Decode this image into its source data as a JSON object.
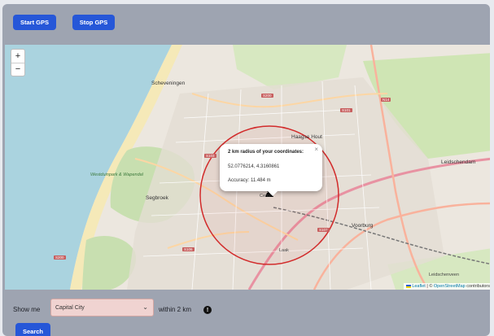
{
  "toolbar": {
    "start_label": "Start GPS",
    "stop_label": "Stop GPS"
  },
  "map": {
    "zoom_in": "+",
    "zoom_out": "−",
    "popup": {
      "close": "×",
      "title": "2 km radius of your coordinates:",
      "coords": "52.0776214, 4.3160861",
      "accuracy": "Accuracy: 11.484 m"
    },
    "attribution": {
      "leaflet": "Leaflet",
      "separator": " | © ",
      "osm": "OpenStreetMap",
      "contributors": " contributors"
    },
    "labels": {
      "scheveningen": "Scheveningen",
      "haagse_hout": "Haagse Hout",
      "segbroek": "Segbroek",
      "voorburg": "Voorburg",
      "leidschendam": "Leidschendam",
      "leidschenveen": "Leidschenveen",
      "laak": "Laak",
      "centrum": "Centr",
      "park": "Westduinpark & Wapendal"
    },
    "roads": {
      "s200": "S200",
      "s101": "S101",
      "s103": "S103",
      "s106": "S106",
      "s107": "S107",
      "n14": "N14"
    },
    "colors": {
      "radius_circle": "#d22b2b",
      "water": "#aad3df",
      "beach": "#f5e9b8",
      "green": "#c8dfb0"
    }
  },
  "search": {
    "show_me_label": "Show me",
    "category_value": "Capital City",
    "within_label": "within 2 km",
    "warning_icon": "!",
    "search_label": "Search"
  }
}
